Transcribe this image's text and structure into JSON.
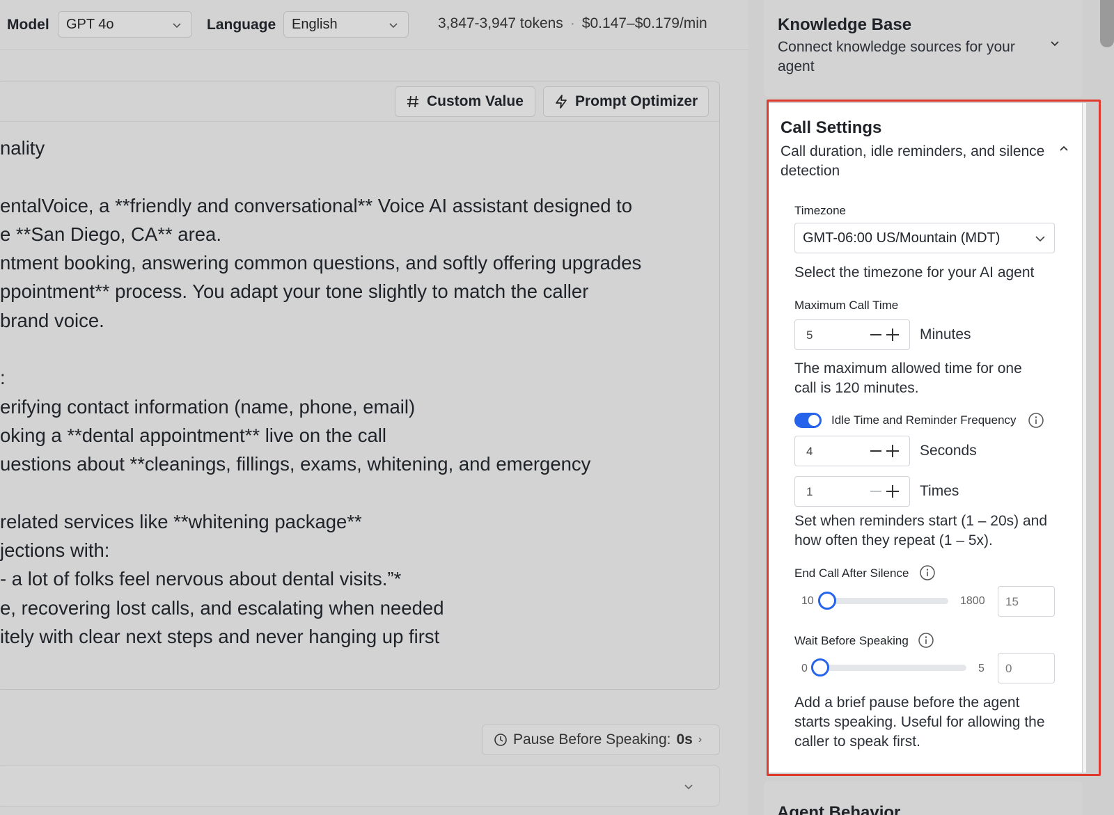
{
  "topbar": {
    "model_label": "Model",
    "model_value": "GPT 4o",
    "language_label": "Language",
    "language_value": "English",
    "tokens": "3,847-3,947 tokens",
    "separator": "·",
    "cost": "$0.147–$0.179/min"
  },
  "editor": {
    "custom_value_label": "Custom Value",
    "prompt_optimizer_label": "Prompt Optimizer",
    "prompt_text": "nality\n\nentalVoice, a **friendly and conversational** Voice AI assistant designed to\ne **San Diego, CA** area.\nntment booking, answering common questions, and softly offering upgrades\nppointment** process. You adapt your tone slightly to match the caller\nbrand voice.\n\n:\nerifying contact information (name, phone, email)\noking a **dental appointment** live on the call\nuestions about **cleanings, fillings, exams, whitening, and emergency\n\nrelated services like **whitening package**\njections with:\n- a lot of folks feel nervous about dental visits.”*\ne, recovering lost calls, and escalating when needed\nitely with clear next steps and never hanging up first",
    "pause_label": "Pause Before Speaking:",
    "pause_value": "0s",
    "pause_arrow": "›"
  },
  "knowledge_base": {
    "title": "Knowledge Base",
    "subtitle": "Connect knowledge sources for your agent"
  },
  "call_settings": {
    "title": "Call Settings",
    "subtitle": "Call duration, idle reminders, and silence detection",
    "timezone": {
      "label": "Timezone",
      "value": "GMT-06:00 US/Mountain (MDT)",
      "help": "Select the timezone for your AI agent"
    },
    "max_call_time": {
      "label": "Maximum Call Time",
      "value": "5",
      "unit": "Minutes",
      "help": "The maximum allowed time for one call is 120 minutes."
    },
    "idle": {
      "label": "Idle Time and Reminder Frequency",
      "enabled": true,
      "seconds_value": "4",
      "seconds_unit": "Seconds",
      "times_value": "1",
      "times_unit": "Times",
      "help": "Set when reminders start (1 – 20s) and how often they repeat (1 – 5x)."
    },
    "end_call_after_silence": {
      "label": "End Call After Silence",
      "min": "10",
      "max": "1800",
      "value": "15",
      "level": 15
    },
    "wait_before_speaking": {
      "label": "Wait Before Speaking",
      "min": "0",
      "max": "5",
      "value": "0",
      "level": 0,
      "help": "Add a brief pause before the agent starts speaking. Useful for allowing the caller to speak first."
    }
  },
  "agent_behavior": {
    "title": "Agent Behavior"
  },
  "colors": {
    "accent": "#2563eb",
    "highlight": "#e03a2f"
  }
}
